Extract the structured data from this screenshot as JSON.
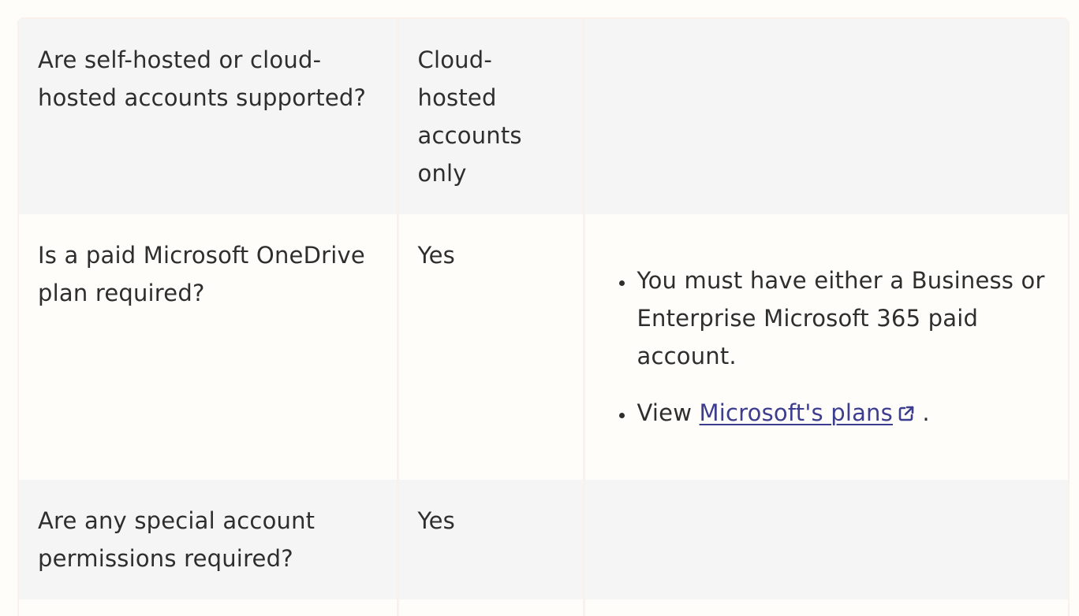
{
  "rows": [
    {
      "question": "Are self-hosted or cloud-hosted accounts supported?",
      "answer": "Cloud-hosted accounts only",
      "notes": []
    },
    {
      "question": "Is a paid Microsoft OneDrive plan required?",
      "answer": "Yes",
      "notes": [
        "You must have either a Business or Enterprise Microsoft 365 paid account."
      ],
      "view_prefix": "View",
      "view_link": "Microsoft's plans",
      "view_suffix": "."
    },
    {
      "question": "Are any special account permissions required?",
      "answer": "Yes",
      "notes": []
    }
  ],
  "icons": {
    "external_link": "external-link-icon"
  },
  "colors": {
    "link": "#3d3d8f",
    "row_shade": "#f5f5f5",
    "row_plain": "#fffdfa"
  }
}
